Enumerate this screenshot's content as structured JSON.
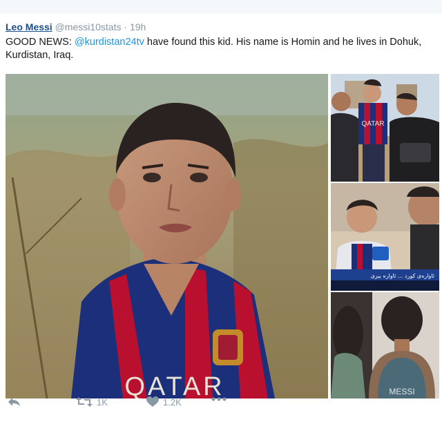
{
  "tweet": {
    "author_name": "Leo Messi",
    "author_handle": "@messi10stats",
    "separator": "·",
    "time": "19h",
    "text_before": "GOOD NEWS: ",
    "mention": "@kurdistan24tv",
    "text_after": " have found this kid. His name is Homin and he lives in Dohuk, Kurdistan, Iraq."
  },
  "media": {
    "main_photo": {
      "shirt_text": "QATAR"
    },
    "thumb_1": {
      "shirt_text": "QATAR"
    },
    "thumb_2": {
      "ticker_text": "ئاوارەی کورد ... ئاوارە بیری"
    },
    "thumb_3": {
      "shirt_text": "MESSI"
    }
  },
  "actions": {
    "reply_icon": "reply-icon",
    "retweet_icon": "retweet-icon",
    "retweet_count": "1K",
    "like_icon": "heart-icon",
    "like_count": "1.2K",
    "more_icon": "more-icon"
  },
  "colors": {
    "author": "#1b4f8a",
    "mention": "#1b95e0",
    "muted": "#8899a6",
    "text": "#14171a",
    "barca_blue": "#1c2f7a",
    "barca_red": "#b8102e"
  }
}
